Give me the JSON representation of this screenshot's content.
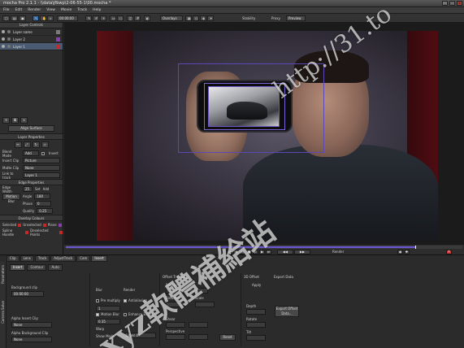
{
  "window": {
    "title": "mocha Pro 2.1.1 - \\\\data\\jfbwp\\2-06-55-1\\00.mocha *",
    "controls": [
      "_",
      "□",
      "x"
    ]
  },
  "menu": [
    "File",
    "Edit",
    "Render",
    "View",
    "Movie",
    "Track",
    "Help"
  ],
  "toolbar": {
    "timecode": "00:00:00",
    "view_mode": "Overlays",
    "stabilize_label": "Stability",
    "proxy_label": "Proxy",
    "proxy_value": "Preview"
  },
  "layer_controls": {
    "header": "Layer Controls",
    "layers": [
      {
        "name": "Layer name",
        "color": "#7a7a7a",
        "selected": false
      },
      {
        "name": "Layer 2",
        "color": "#8a3fb0",
        "selected": false
      },
      {
        "name": "Layer 1",
        "color": "#c42a2a",
        "selected": true
      }
    ],
    "align_button": "Align Surface"
  },
  "layer_properties": {
    "header": "Layer Properties",
    "blend_mode_label": "Blend Mode",
    "blend_mode_value": "Add",
    "invert_label": "Invert",
    "insert_clip_label": "Insert Clip",
    "insert_clip_value": "Picture",
    "matte_clip_label": "Matte Clip",
    "matte_clip_value": "None",
    "link_to_track_label": "Link to track",
    "link_to_track_value": "Layer 1"
  },
  "edge_properties": {
    "header": "Edge Properties",
    "edge_width_label": "Edge Width",
    "edge_width_value": "25",
    "set_label": "Set",
    "add_label": "Add",
    "motion_blur_label": "Motion Blur",
    "angle_label": "Angle",
    "angle_value": "180",
    "phase_label": "Phase",
    "phase_value": "0",
    "quality_label": "Quality",
    "quality_value": "0.25"
  },
  "overlay_colors": {
    "header": "Overlay Colours",
    "selected_label": "Selected",
    "unselected_label": "Unselected",
    "plane_label": "Plane",
    "selected_color": "#c42a2a",
    "unselected_color": "#c42a2a",
    "plane_color": "#8a3fb0",
    "spline_label": "Spline Handle",
    "deselect_label": "Deselected Points"
  },
  "timeline": {
    "label": "Parameters",
    "track_label": "Track",
    "render_label": "Render",
    "key_label": "Key"
  },
  "bottom_tabs": [
    "Clip",
    "Lens",
    "Track",
    "AdjustTrack",
    "Cam",
    "Insert"
  ],
  "side_tabs": [
    "Parameters",
    "Camera Solve"
  ],
  "insert_panel": {
    "subtabs": [
      "Insert",
      "Contour",
      "Auto"
    ],
    "background_clip_label": "Background clip",
    "background_clip_value": "00:00:00",
    "blur_label": "Blur",
    "blur_value": "1",
    "render_label": "Render",
    "premultiply_label": "Pre multiply",
    "antialiasing_label": "Antialiasing",
    "motion_blur_label": "Motion Blur",
    "enhance_edges_label": "Enhance Edges",
    "motion_blur_value": "0.35",
    "warp_label": "Warp",
    "alpha_insert_label": "Alpha Insert Clip",
    "alpha_insert_value": "None",
    "alpha_bg_label": "Alpha Background Clip",
    "alpha_bg_value": "None",
    "show_mode_label": "Show Mode",
    "show_mode_value": "Layer 4",
    "offset_header": "Offset Tracking",
    "position_label": "Position",
    "rotation_label": "Rotation",
    "scale_label": "Scale",
    "shear_label": "Shear",
    "perspective_label": "Perspective",
    "reset_label": "Reset",
    "three_d_header": "3D Offset",
    "apply_label": "Apply",
    "depth_label": "Depth",
    "rotate_label": "Rotate",
    "tilt_label": "Tilt",
    "export_header": "Export Data",
    "export_button": "Export Offset Data..."
  },
  "watermark": {
    "url": "http://31.to",
    "cjk": "xyz軟體補給站"
  }
}
